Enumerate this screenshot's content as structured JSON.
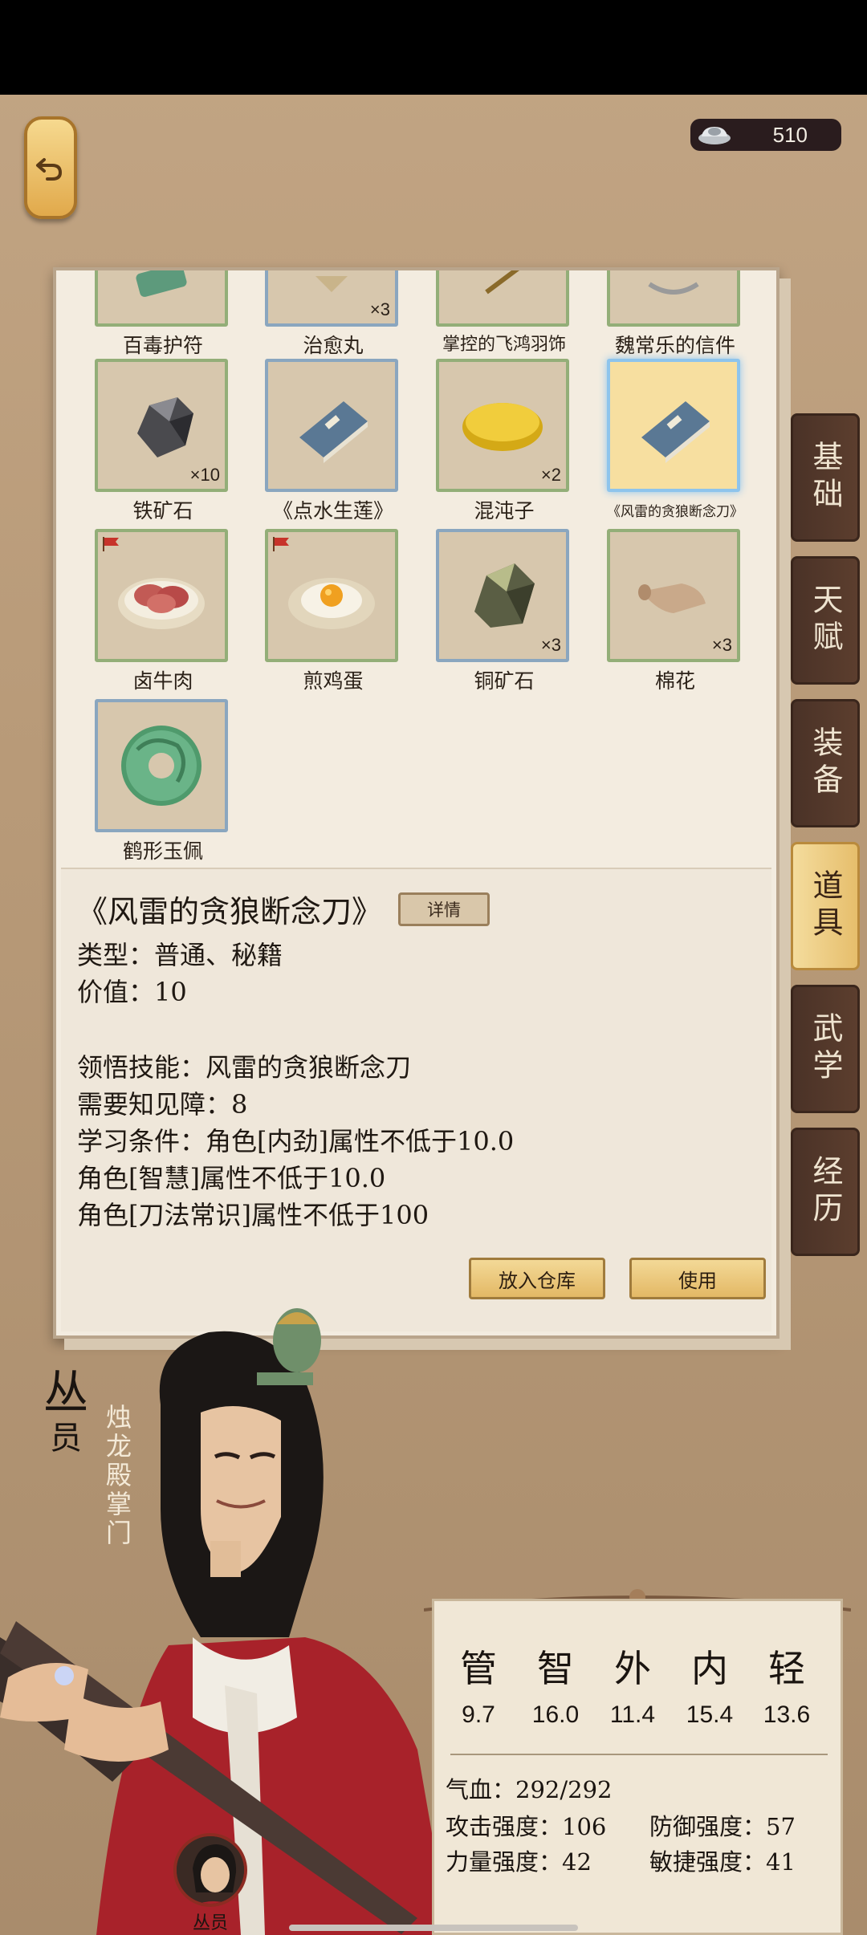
{
  "currency": {
    "amount": "510",
    "icon": "silver-ingot-icon"
  },
  "tabs": [
    {
      "label": "基础",
      "active": false
    },
    {
      "label": "天赋",
      "active": false
    },
    {
      "label": "装备",
      "active": false
    },
    {
      "label": "道具",
      "active": true
    },
    {
      "label": "武学",
      "active": false
    },
    {
      "label": "经历",
      "active": false
    }
  ],
  "items": [
    {
      "name": "百毒护符",
      "qty": ""
    },
    {
      "name": "治愈丸",
      "qty": "×3"
    },
    {
      "name": "掌控的飞鸿羽饰",
      "qty": ""
    },
    {
      "name": "魏常乐的信件",
      "qty": ""
    },
    {
      "name": "铁矿石",
      "qty": "×10"
    },
    {
      "name": "《点水生莲》",
      "qty": ""
    },
    {
      "name": "混沌子",
      "qty": "×2"
    },
    {
      "name": "《风雷的贪狼断念刀》",
      "qty": ""
    },
    {
      "name": "卤牛肉",
      "qty": ""
    },
    {
      "name": "煎鸡蛋",
      "qty": ""
    },
    {
      "name": "铜矿石",
      "qty": "×3"
    },
    {
      "name": "棉花",
      "qty": "×3"
    },
    {
      "name": "鹤形玉佩",
      "qty": ""
    }
  ],
  "detail": {
    "title": "《风雷的贪狼断念刀》",
    "detail_button": "详情",
    "type_line": "类型：普通、秘籍",
    "value_line": "价值：10",
    "skill_line": "领悟技能：风雷的贪狼断念刀",
    "barrier_line": "需要知见障：8",
    "cond_line1": "学习条件：角色[内劲]属性不低于10.0",
    "cond_line2": "角色[智慧]属性不低于10.0",
    "cond_line3": "角色[刀法常识]属性不低于100",
    "store_button": "放入仓库",
    "use_button": "使用"
  },
  "character": {
    "name": "丛员",
    "name_first": "丛",
    "name_second": "员",
    "sect_title": "烛龙殿掌门",
    "avatar_label": "丛员"
  },
  "stats": {
    "attrs": [
      {
        "label": "管",
        "value": "9.7"
      },
      {
        "label": "智",
        "value": "16.0"
      },
      {
        "label": "外",
        "value": "11.4"
      },
      {
        "label": "内",
        "value": "15.4"
      },
      {
        "label": "轻",
        "value": "13.6"
      }
    ],
    "hp": "气血：292/292",
    "attack": "攻击强度：106",
    "defense": "防御强度：57",
    "power": "力量强度：42",
    "agility": "敏捷强度：41"
  },
  "colors": {
    "active_tab": "#f4dc9d",
    "inactive_tab": "#4a3227",
    "selected_border": "#8ec4ec",
    "item_border": "#93ae78"
  }
}
